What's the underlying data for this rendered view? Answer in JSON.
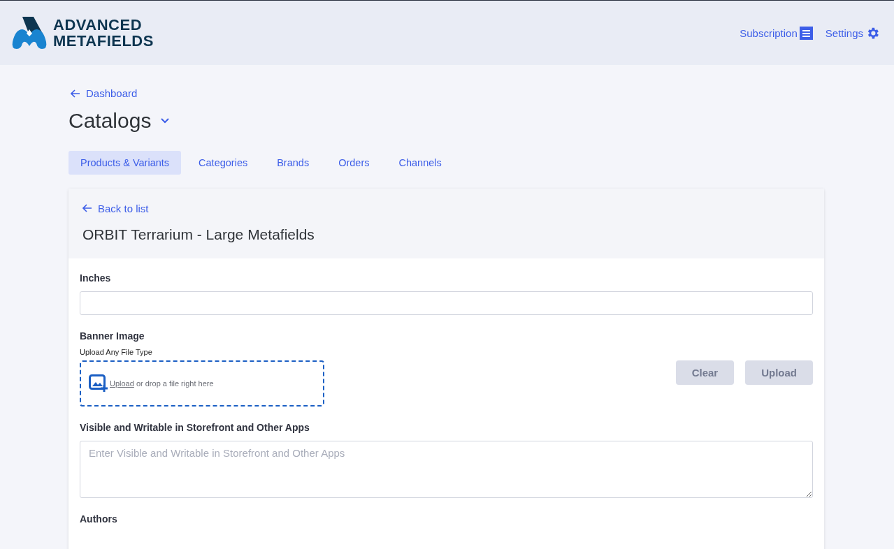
{
  "header": {
    "logo": [
      "ADVANCED",
      "METAFIELDS"
    ],
    "links": [
      {
        "label": "Subscription",
        "kind": "subscription"
      },
      {
        "label": "Settings",
        "kind": "settings"
      }
    ]
  },
  "breadcrumb": "Dashboard",
  "page_title": "Catalogs",
  "tabs": [
    {
      "label": "Products & Variants",
      "selected": true
    },
    {
      "label": "Categories",
      "selected": false
    },
    {
      "label": "Brands",
      "selected": false
    },
    {
      "label": "Orders",
      "selected": false
    },
    {
      "label": "Channels",
      "selected": false
    }
  ],
  "card": {
    "back_link": "Back to list",
    "title": "ORBIT Terrarium - Large Metafields",
    "fields": [
      {
        "kind": "text",
        "label": "Inches"
      },
      {
        "kind": "file",
        "label": "Banner Image",
        "hint": "Upload Any File Type",
        "link": "Upload",
        "drop_text": " or drop a file right here",
        "buttons": [
          {
            "label": "Clear",
            "disabled": true
          },
          {
            "label": "Upload",
            "disabled": true
          }
        ]
      },
      {
        "kind": "textarea",
        "label": "Visible and Writable in Storefront and Other Apps",
        "placeholder": "Enter Visible and Writable in Storefront and Other Apps"
      },
      {
        "kind": "heading",
        "label": "Authors"
      }
    ]
  }
}
